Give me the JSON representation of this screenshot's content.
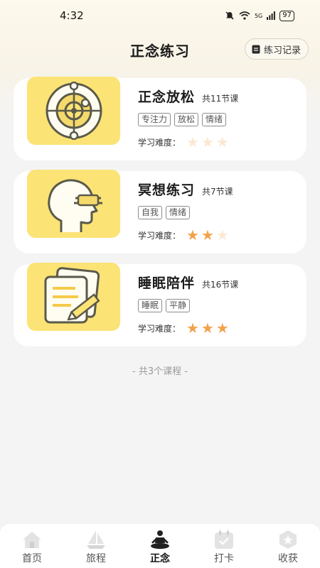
{
  "status_bar": {
    "time": "4:32",
    "battery": "97",
    "network": "5G"
  },
  "header": {
    "title": "正念练习",
    "record_label": "练习记录"
  },
  "difficulty_label": "学习难度：",
  "courses": [
    {
      "title": "正念放松",
      "lessons": "共11节课",
      "tags": [
        "专注力",
        "放松",
        "情绪"
      ],
      "difficulty": 0,
      "icon": "orbit-target-icon"
    },
    {
      "title": "冥想练习",
      "lessons": "共7节课",
      "tags": [
        "自我",
        "情绪"
      ],
      "difficulty": 2,
      "icon": "head-meditation-icon"
    },
    {
      "title": "睡眠陪伴",
      "lessons": "共16节课",
      "tags": [
        "睡眠",
        "平静"
      ],
      "difficulty": 3,
      "icon": "notepad-pencil-icon"
    }
  ],
  "max_difficulty": 3,
  "footer_note": "- 共3个课程 -",
  "tabs": [
    {
      "label": "首页",
      "icon": "home-icon",
      "active": false
    },
    {
      "label": "旅程",
      "icon": "sailboat-icon",
      "active": false
    },
    {
      "label": "正念",
      "icon": "meditation-person-icon",
      "active": true
    },
    {
      "label": "打卡",
      "icon": "calendar-check-icon",
      "active": false
    },
    {
      "label": "收获",
      "icon": "hexagon-star-icon",
      "active": false
    }
  ],
  "colors": {
    "accent": "#f2a24a",
    "thumb_bg": "#fbe375",
    "star_off": "#fbe8d2"
  }
}
